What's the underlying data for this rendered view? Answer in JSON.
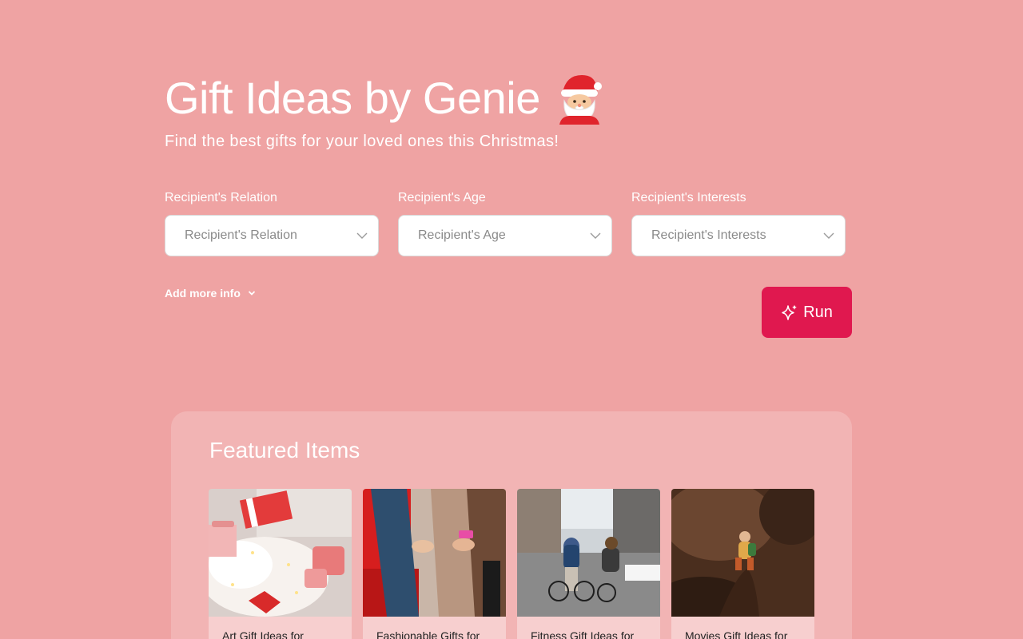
{
  "header": {
    "title": "Gift Ideas by Genie",
    "title_emoji_icon": "santa-claus-icon",
    "subtitle": "Find the best gifts for your loved ones this Christmas!"
  },
  "form": {
    "relation": {
      "label": "Recipient's Relation",
      "placeholder": "Recipient's Relation"
    },
    "age": {
      "label": "Recipient's Age",
      "placeholder": "Recipient's Age"
    },
    "interests": {
      "label": "Recipient's Interests",
      "placeholder": "Recipient's Interests"
    },
    "add_more_label": "Add more info",
    "run_label": "Run"
  },
  "featured": {
    "title": "Featured Items",
    "items": [
      {
        "label": "Art Gift Ideas for"
      },
      {
        "label": "Fashionable Gifts for"
      },
      {
        "label": "Fitness Gift Ideas for"
      },
      {
        "label": "Movies Gift Ideas for"
      }
    ]
  },
  "colors": {
    "background": "#EFA3A3",
    "accent": "#E0184F",
    "panel": "#F2B4B4"
  }
}
